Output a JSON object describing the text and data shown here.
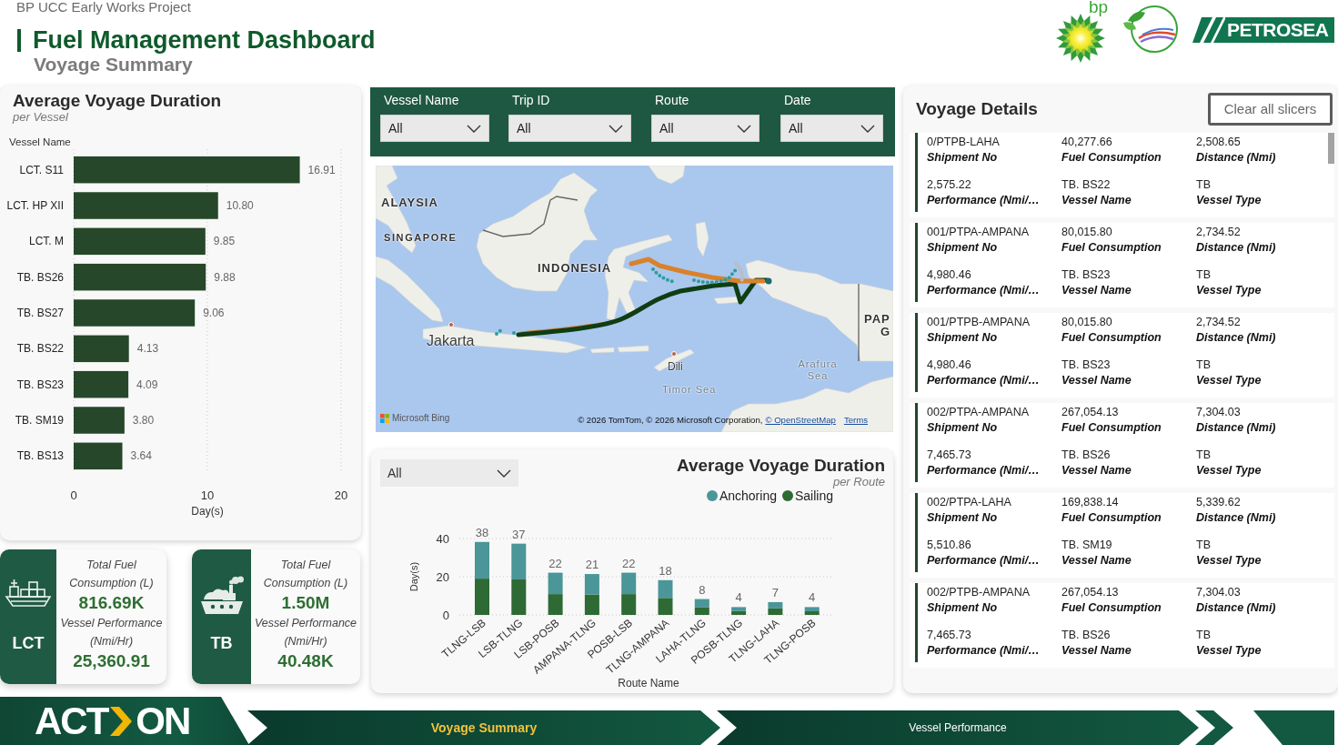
{
  "header": {
    "project": "BP UCC Early Works Project",
    "title": "Fuel Management Dashboard",
    "subtitle": "Voyage Summary"
  },
  "logos": [
    {
      "kind": "bp",
      "text": "bp"
    },
    {
      "kind": "circle-leaf"
    },
    {
      "kind": "petrosea",
      "text": "PETROSEA"
    }
  ],
  "vessel_chart": {
    "subtitle": "per Vessel",
    "chart_data": {
      "type": "bar",
      "orientation": "horizontal",
      "title": "Average Voyage Duration",
      "ylabel": "Vessel Name",
      "xlabel": "Day(s)",
      "categories": [
        "LCT. S11",
        "LCT. HP XII",
        "LCT. M",
        "TB. BS26",
        "TB. BS27",
        "TB. BS22",
        "TB. BS23",
        "TB. SM19",
        "TB. BS13"
      ],
      "values": [
        16.91,
        10.8,
        9.85,
        9.88,
        9.06,
        4.13,
        4.09,
        3.8,
        3.64
      ],
      "xlim": [
        0,
        20
      ],
      "xticks": [
        0,
        10,
        20
      ],
      "value_labels": [
        "16.91",
        "10.80",
        "9.85",
        "9.88",
        "9.06",
        "4.13",
        "4.09",
        "3.80",
        "3.64"
      ]
    }
  },
  "kpi_cards": [
    {
      "kind": "cargo-ship",
      "vessel_type": "LCT",
      "fuel_label": "Total Fuel Consumption (L)",
      "fuel_value": "816.69K",
      "performance_label": "Vessel Performance (Nmi/Hr)",
      "performance_value": "25,360.91"
    },
    {
      "kind": "tugboat",
      "vessel_type": "TB",
      "fuel_label": "Total Fuel Consumption (L)",
      "fuel_value": "1.50M",
      "performance_label": "Vessel Performance (Nmi/Hr)",
      "performance_value": "40.48K"
    }
  ],
  "slicers": [
    {
      "label": "Vessel Name",
      "value": "All"
    },
    {
      "label": "Trip ID",
      "value": "All"
    },
    {
      "label": "Route",
      "value": "All"
    },
    {
      "label": "Date",
      "value": "All"
    }
  ],
  "map": {
    "place_labels": [
      {
        "text": "ALAYSIA",
        "kind": "country"
      },
      {
        "text": "SINGAPORE",
        "kind": "country"
      },
      {
        "text": "INDONESIA",
        "kind": "country"
      },
      {
        "text": "Jakarta",
        "kind": "city"
      },
      {
        "text": "Dili",
        "kind": "city"
      },
      {
        "text": "Timor Sea",
        "kind": "sea"
      },
      {
        "text": "Arafura Sea",
        "kind": "sea"
      },
      {
        "text": "PAP",
        "kind": "country"
      },
      {
        "text": "G",
        "kind": "country"
      }
    ],
    "provider": "Microsoft Bing",
    "attribution": "© 2026 TomTom, © 2026 Microsoft Corporation,",
    "links": [
      "© OpenStreetMap",
      "Terms"
    ]
  },
  "route_chart": {
    "filter": "All",
    "subtitle": "per Route",
    "chart_data": {
      "type": "bar",
      "stacked": true,
      "legend": "top-right",
      "title": "Average Voyage Duration",
      "xlabel": "Route Name",
      "ylabel": "Day(s)",
      "categories": [
        "TLNG-LSB",
        "LSB-TLNG",
        "LSB-POSB",
        "AMPANA-TLNG",
        "POSB-LSB",
        "TLNG-AMPANA",
        "LAHA-TLNG",
        "POSB-TLNG",
        "TLNG-LAHA",
        "TLNG-POSB"
      ],
      "series": [
        {
          "name": "Anchoring",
          "color": "#4a9698",
          "values": [
            19.2,
            18.7,
            11.2,
            10.7,
            11.2,
            9.3,
            4.2,
            2.1,
            3.3,
            2.2
          ]
        },
        {
          "name": "Sailing",
          "color": "#2e6a34",
          "values": [
            19,
            18.6,
            10.9,
            10.7,
            10.9,
            8.9,
            4.1,
            2,
            3.4,
            1.9
          ]
        }
      ],
      "ylim": [
        0,
        40
      ],
      "yticks": [
        0,
        20,
        40
      ],
      "value_labels": [
        "38",
        "37",
        "22",
        "21",
        "22",
        "18",
        "8",
        "4",
        "7",
        "4"
      ]
    }
  },
  "voyage_details": {
    "title": "Voyage Details",
    "clear_button": "Clear all slicers",
    "cards": [
      {
        "fields": [
          {
            "value": "0/PTPB-LAHA",
            "label": "Shipment No"
          },
          {
            "value": "40,277.66",
            "label": "Fuel Consumption"
          },
          {
            "value": "2,508.65",
            "label": "Distance (Nmi)"
          },
          {
            "value": "2,575.22",
            "label": "Performance (Nmi/…"
          },
          {
            "value": "TB. BS22",
            "label": "Vessel Name"
          },
          {
            "value": "TB",
            "label": "Vessel Type"
          }
        ]
      },
      {
        "fields": [
          {
            "value": "001/PTPA-AMPANA",
            "label": "Shipment No"
          },
          {
            "value": "80,015.80",
            "label": "Fuel Consumption"
          },
          {
            "value": "2,734.52",
            "label": "Distance (Nmi)"
          },
          {
            "value": "4,980.46",
            "label": "Performance (Nmi/…"
          },
          {
            "value": "TB. BS23",
            "label": "Vessel Name"
          },
          {
            "value": "TB",
            "label": "Vessel Type"
          }
        ]
      },
      {
        "fields": [
          {
            "value": "001/PTPB-AMPANA",
            "label": "Shipment No"
          },
          {
            "value": "80,015.80",
            "label": "Fuel Consumption"
          },
          {
            "value": "2,734.52",
            "label": "Distance (Nmi)"
          },
          {
            "value": "4,980.46",
            "label": "Performance (Nmi/…"
          },
          {
            "value": "TB. BS23",
            "label": "Vessel Name"
          },
          {
            "value": "TB",
            "label": "Vessel Type"
          }
        ]
      },
      {
        "fields": [
          {
            "value": "002/PTPA-AMPANA",
            "label": "Shipment No"
          },
          {
            "value": "267,054.13",
            "label": "Fuel Consumption"
          },
          {
            "value": "7,304.03",
            "label": "Distance (Nmi)"
          },
          {
            "value": "7,465.73",
            "label": "Performance (Nmi/…"
          },
          {
            "value": "TB. BS26",
            "label": "Vessel Name"
          },
          {
            "value": "TB",
            "label": "Vessel Type"
          }
        ]
      },
      {
        "fields": [
          {
            "value": "002/PTPA-LAHA",
            "label": "Shipment No"
          },
          {
            "value": "169,838.14",
            "label": "Fuel Consumption"
          },
          {
            "value": "5,339.62",
            "label": "Distance (Nmi)"
          },
          {
            "value": "5,510.86",
            "label": "Performance (Nmi/…"
          },
          {
            "value": "TB. SM19",
            "label": "Vessel Name"
          },
          {
            "value": "TB",
            "label": "Vessel Type"
          }
        ]
      },
      {
        "fields": [
          {
            "value": "002/PTPB-AMPANA",
            "label": "Shipment No"
          },
          {
            "value": "267,054.13",
            "label": "Fuel Consumption"
          },
          {
            "value": "7,304.03",
            "label": "Distance (Nmi)"
          },
          {
            "value": "7,465.73",
            "label": "Performance (Nmi/…"
          },
          {
            "value": "TB. BS26",
            "label": "Vessel Name"
          },
          {
            "value": "TB",
            "label": "Vessel Type"
          }
        ]
      }
    ]
  },
  "footer": {
    "logo": {
      "text_before": "ACT",
      "text_after": "ON"
    },
    "tabs": [
      {
        "label": "Voyage Summary",
        "selected": true
      },
      {
        "label": "Vessel Performance",
        "selected": false
      }
    ]
  }
}
